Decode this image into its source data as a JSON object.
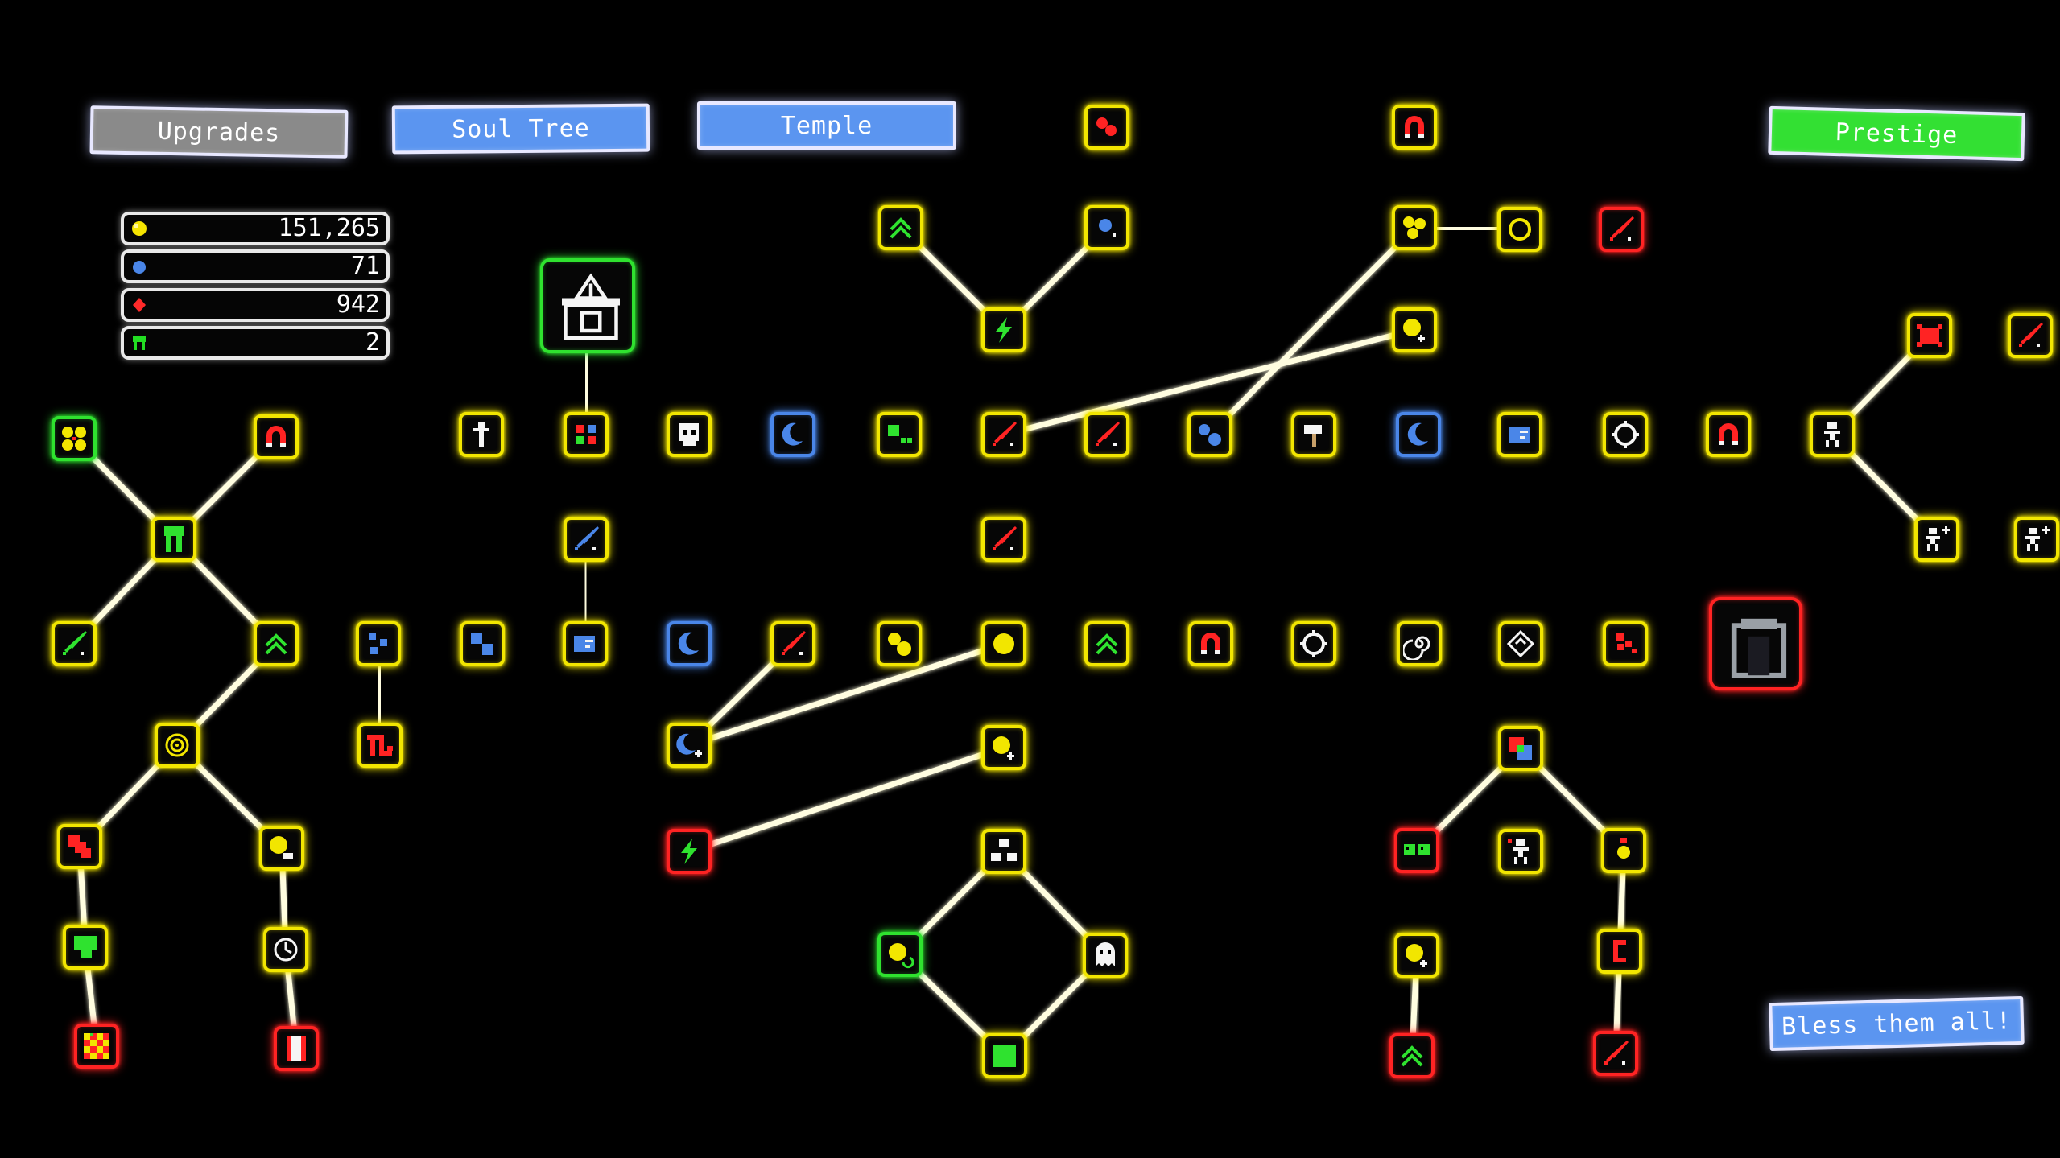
{
  "tabs": {
    "upgrades": "Upgrades",
    "soul_tree": "Soul Tree",
    "temple": "Temple",
    "prestige": "Prestige",
    "bless_all": "Bless them all!"
  },
  "resources": [
    {
      "name": "coins",
      "icon": "coin-icon",
      "color": "#f5e400",
      "value": "151,265"
    },
    {
      "name": "souls",
      "icon": "soul-icon",
      "color": "#4a86e8",
      "value": "71"
    },
    {
      "name": "gems",
      "icon": "gem-icon",
      "color": "#ff2a2a",
      "value": "942"
    },
    {
      "name": "followers",
      "icon": "follower-icon",
      "color": "#22dd22",
      "value": "2"
    }
  ],
  "colors": {
    "yellow": "#f2e600",
    "green": "#2fe22f",
    "red": "#ff2323",
    "blue": "#4a86e8",
    "link": "#fffde0",
    "tab_blue": "#5b95f0",
    "tab_gray": "#8a8a8a",
    "tab_green": "#33e033"
  },
  "nodes": [
    {
      "id": "n1",
      "icon": "red-dots-icon",
      "color": "yellow"
    },
    {
      "id": "n2",
      "icon": "magnet-icon",
      "color": "yellow"
    },
    {
      "id": "n3",
      "icon": "chevron-up-icon",
      "color": "yellow"
    },
    {
      "id": "n4",
      "icon": "blue-dot-icon",
      "color": "yellow"
    },
    {
      "id": "n5",
      "icon": "triple-dot-icon",
      "color": "yellow"
    },
    {
      "id": "n6",
      "icon": "ring-icon",
      "color": "yellow"
    },
    {
      "id": "n7",
      "icon": "red-sword-icon",
      "color": "red"
    },
    {
      "id": "n8",
      "icon": "lightning-icon",
      "color": "yellow"
    },
    {
      "id": "n9",
      "icon": "coin-plus-icon",
      "color": "yellow"
    },
    {
      "id": "n10",
      "icon": "red-sword-icon",
      "color": "yellow"
    },
    {
      "id": "n11",
      "icon": "red-sword-icon",
      "color": "yellow"
    },
    {
      "id": "n12",
      "icon": "double-blue-dot-icon",
      "color": "yellow"
    },
    {
      "id": "n13",
      "icon": "hammer-icon",
      "color": "yellow"
    },
    {
      "id": "n14",
      "icon": "blue-moon-icon",
      "color": "blue"
    },
    {
      "id": "n15",
      "icon": "dash-icon",
      "color": "yellow"
    },
    {
      "id": "n16",
      "icon": "gear-ring-icon",
      "color": "yellow"
    },
    {
      "id": "n17",
      "icon": "magnet-icon",
      "color": "yellow"
    },
    {
      "id": "n18",
      "icon": "walker-icon",
      "color": "yellow"
    },
    {
      "id": "n19",
      "icon": "red-splat-icon",
      "color": "yellow"
    },
    {
      "id": "n20",
      "icon": "red-sword-icon",
      "color": "yellow"
    },
    {
      "id": "n21",
      "icon": "walker-plus-icon",
      "color": "yellow"
    },
    {
      "id": "n22",
      "icon": "walker-plus-icon",
      "color": "yellow"
    },
    {
      "id": "n23",
      "icon": "totem-icon",
      "color": "yellow"
    },
    {
      "id": "n24",
      "icon": "temple-icon",
      "color": "green"
    },
    {
      "id": "n25",
      "icon": "color-grid-icon",
      "color": "yellow"
    },
    {
      "id": "n26",
      "icon": "skull-icon",
      "color": "yellow"
    },
    {
      "id": "n27",
      "icon": "blue-moon-icon",
      "color": "blue"
    },
    {
      "id": "n28",
      "icon": "green-blocks-icon",
      "color": "yellow"
    },
    {
      "id": "n29",
      "icon": "blue-sword-icon",
      "color": "yellow"
    },
    {
      "id": "n30",
      "icon": "red-sword-icon",
      "color": "yellow"
    },
    {
      "id": "n31",
      "icon": "multi-coin-icon",
      "color": "green"
    },
    {
      "id": "n32",
      "icon": "magnet-icon",
      "color": "yellow"
    },
    {
      "id": "n33",
      "icon": "follower-icon",
      "color": "yellow"
    },
    {
      "id": "n34",
      "icon": "green-sword-icon",
      "color": "yellow"
    },
    {
      "id": "n35",
      "icon": "chevron-up-icon",
      "color": "yellow"
    },
    {
      "id": "n36",
      "icon": "blue-cluster-icon",
      "color": "yellow"
    },
    {
      "id": "n37",
      "icon": "blue-blocks-icon",
      "color": "yellow"
    },
    {
      "id": "n38",
      "icon": "dash-icon",
      "color": "yellow"
    },
    {
      "id": "n39",
      "icon": "blue-moon-icon",
      "color": "blue"
    },
    {
      "id": "n40",
      "icon": "red-sword-icon",
      "color": "yellow"
    },
    {
      "id": "n41",
      "icon": "double-coin-icon",
      "color": "yellow"
    },
    {
      "id": "n42",
      "icon": "coin-icon",
      "color": "yellow"
    },
    {
      "id": "n43",
      "icon": "chevron-up-icon",
      "color": "yellow"
    },
    {
      "id": "n44",
      "icon": "magnet-icon",
      "color": "yellow"
    },
    {
      "id": "n45",
      "icon": "gear-ring-icon",
      "color": "yellow"
    },
    {
      "id": "n46",
      "icon": "spiral-icon",
      "color": "yellow"
    },
    {
      "id": "n47",
      "icon": "diamond-arrow-icon",
      "color": "yellow"
    },
    {
      "id": "n48",
      "icon": "red-blocks-icon",
      "color": "yellow"
    },
    {
      "id": "n49",
      "icon": "portal-icon",
      "color": "red"
    },
    {
      "id": "n50",
      "icon": "target-icon",
      "color": "yellow"
    },
    {
      "id": "n51",
      "icon": "red-pipe-icon",
      "color": "yellow"
    },
    {
      "id": "n52",
      "icon": "blue-moon-plus-icon",
      "color": "yellow"
    },
    {
      "id": "n53",
      "icon": "lightning-icon",
      "color": "red"
    },
    {
      "id": "n54",
      "icon": "coin-plus-icon",
      "color": "yellow"
    },
    {
      "id": "n55",
      "icon": "group-icon",
      "color": "yellow"
    },
    {
      "id": "n56",
      "icon": "rgb-gem-icon",
      "color": "yellow"
    },
    {
      "id": "n57",
      "icon": "red-stairs-icon",
      "color": "yellow"
    },
    {
      "id": "n58",
      "icon": "coin-stack-icon",
      "color": "yellow"
    },
    {
      "id": "n59",
      "icon": "green-blob-icon",
      "color": "yellow"
    },
    {
      "id": "n60",
      "icon": "twin-face-icon",
      "color": "red"
    },
    {
      "id": "n61",
      "icon": "walker-arrow-icon",
      "color": "yellow"
    },
    {
      "id": "n62",
      "icon": "gem-coin-icon",
      "color": "yellow"
    },
    {
      "id": "n63",
      "icon": "crescent-icon",
      "color": "yellow"
    },
    {
      "id": "n64",
      "icon": "clock-icon",
      "color": "yellow"
    },
    {
      "id": "n65",
      "icon": "coin-refresh-icon",
      "color": "green"
    },
    {
      "id": "n66",
      "icon": "ghost-icon",
      "color": "yellow"
    },
    {
      "id": "n67",
      "icon": "coin-plus-icon",
      "color": "yellow"
    },
    {
      "id": "n68",
      "icon": "checker-icon",
      "color": "red"
    },
    {
      "id": "n69",
      "icon": "red-bar-icon",
      "color": "red"
    },
    {
      "id": "n70",
      "icon": "green-square-icon",
      "color": "yellow"
    },
    {
      "id": "n71",
      "icon": "chevron-up-icon",
      "color": "red"
    },
    {
      "id": "n72",
      "icon": "red-sword-icon",
      "color": "red"
    }
  ]
}
